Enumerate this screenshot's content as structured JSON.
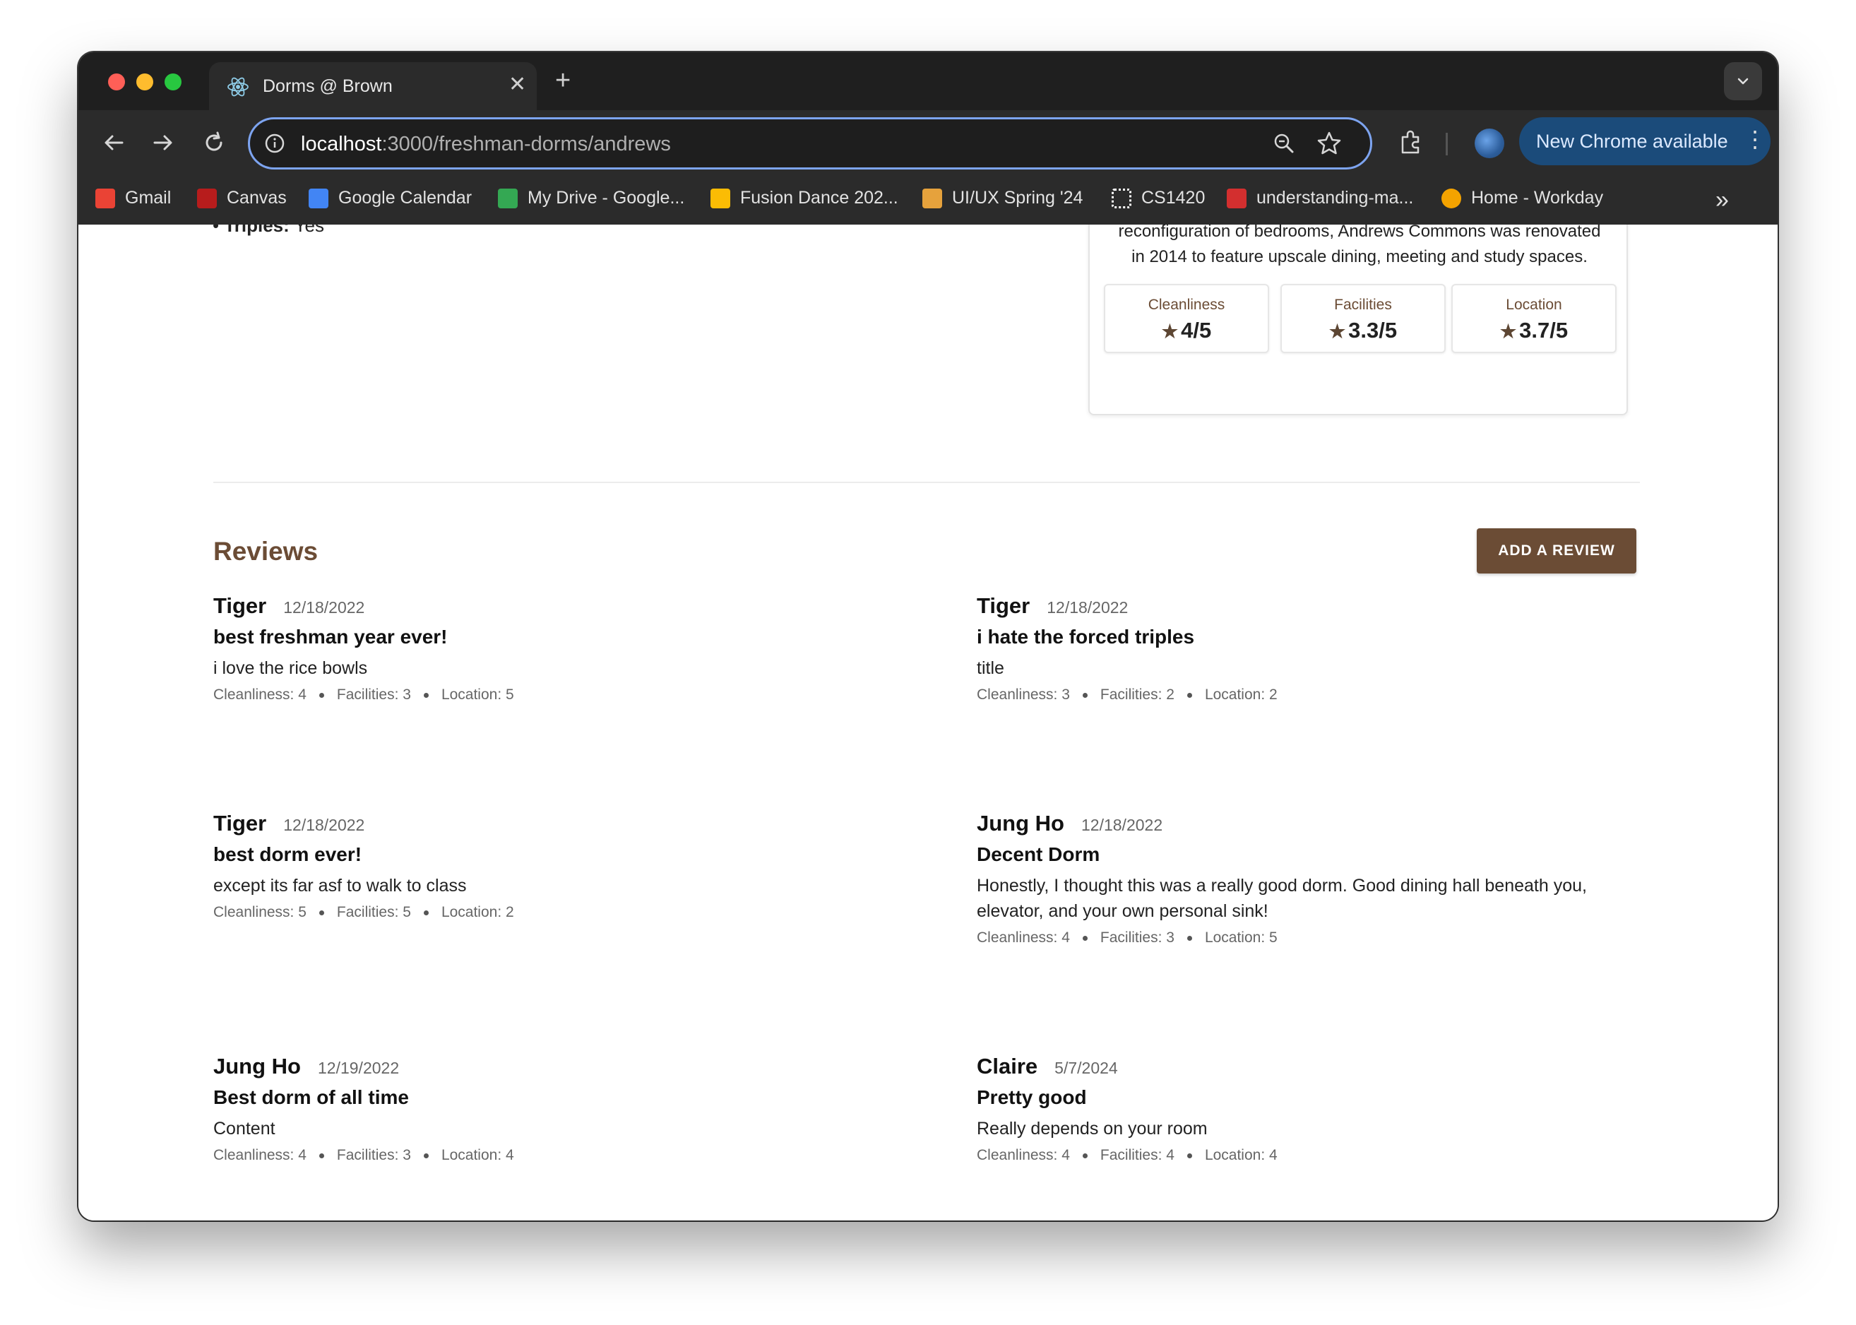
{
  "browser": {
    "tab_title": "Dorms @ Brown",
    "url_host": "localhost",
    "url_path": ":3000/freshman-dorms/andrews",
    "update_label": "New Chrome available",
    "bookmarks": [
      {
        "label": "Gmail",
        "color": "#ea4335"
      },
      {
        "label": "Canvas",
        "color": "#b71c1c"
      },
      {
        "label": "Google Calendar",
        "color": "#4285f4"
      },
      {
        "label": "My Drive - Google...",
        "color": "#34a853"
      },
      {
        "label": "Fusion Dance 202...",
        "color": "#fbbc04"
      },
      {
        "label": "UI/UX Spring '24",
        "color": "#e6a23c"
      },
      {
        "label": "CS1420",
        "color": "#ffffff"
      },
      {
        "label": "understanding-ma...",
        "color": "#d32f2f"
      },
      {
        "label": "Home - Workday",
        "color": "#f4a300"
      }
    ]
  },
  "dorm": {
    "triples_label": "Triples:",
    "triples_value": "Yes",
    "description_line1": "reconfiguration of bedrooms, Andrews Commons was renovated",
    "description_line2": "in 2014 to feature upscale dining, meeting and study spaces.",
    "ratings": [
      {
        "label": "Cleanliness",
        "value": "4/5"
      },
      {
        "label": "Facilities",
        "value": "3.3/5"
      },
      {
        "label": "Location",
        "value": "3.7/5"
      }
    ]
  },
  "reviews": {
    "heading": "Reviews",
    "add_button": "ADD A REVIEW",
    "items": [
      {
        "author": "Tiger",
        "date": "12/18/2022",
        "title": "best freshman year ever!",
        "body": "i love the rice bowls",
        "cleanliness": "Cleanliness: 4",
        "facilities": "Facilities: 3",
        "location": "Location: 5"
      },
      {
        "author": "Tiger",
        "date": "12/18/2022",
        "title": "i hate the forced triples",
        "body": "title",
        "cleanliness": "Cleanliness: 3",
        "facilities": "Facilities: 2",
        "location": "Location: 2"
      },
      {
        "author": "Tiger",
        "date": "12/18/2022",
        "title": "best dorm ever!",
        "body": "except its far asf to walk to class",
        "cleanliness": "Cleanliness: 5",
        "facilities": "Facilities: 5",
        "location": "Location: 2"
      },
      {
        "author": "Jung Ho",
        "date": "12/18/2022",
        "title": "Decent Dorm",
        "body": "Honestly, I thought this was a really good dorm. Good dining hall beneath you, elevator, and your own personal sink!",
        "cleanliness": "Cleanliness: 4",
        "facilities": "Facilities: 3",
        "location": "Location: 5"
      },
      {
        "author": "Jung Ho",
        "date": "12/19/2022",
        "title": "Best dorm of all time",
        "body": "Content",
        "cleanliness": "Cleanliness: 4",
        "facilities": "Facilities: 3",
        "location": "Location: 4"
      },
      {
        "author": "Claire",
        "date": "5/7/2024",
        "title": "Pretty good",
        "body": "Really depends on your room",
        "cleanliness": "Cleanliness: 4",
        "facilities": "Facilities: 4",
        "location": "Location: 4"
      }
    ]
  },
  "colors": {
    "accent": "#6b4c35",
    "chrome_dark": "#2b2b2b",
    "update_pill": "#1b4b7a"
  }
}
